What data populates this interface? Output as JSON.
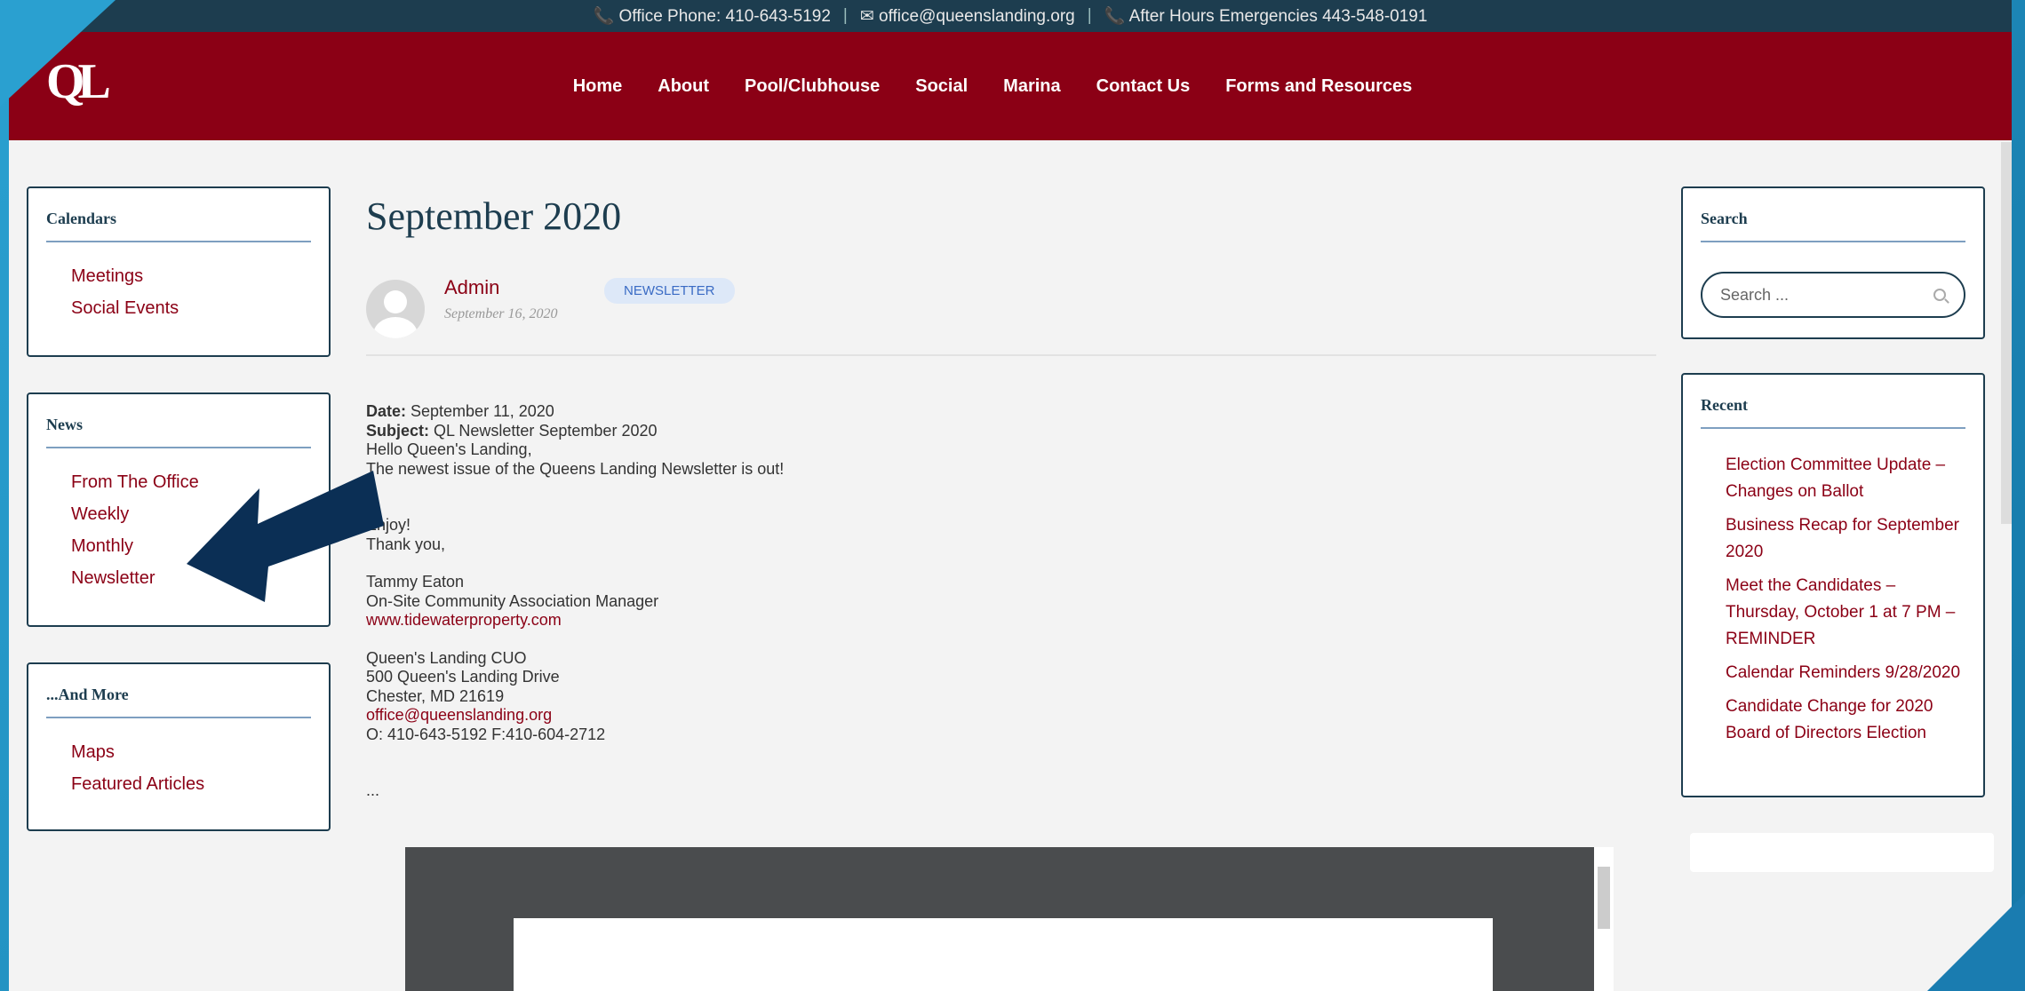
{
  "topbar": {
    "phone": "📞 Office Phone: 410-643-5192",
    "email": "✉ office@queenslanding.org",
    "emergency": "📞 After Hours Emergencies 443-548-0191",
    "separator": "|"
  },
  "logo": "QL",
  "nav": [
    "Home",
    "About",
    "Pool/Clubhouse",
    "Social",
    "Marina",
    "Contact Us",
    "Forms and Resources"
  ],
  "left_widgets": {
    "calendars": {
      "title": "Calendars",
      "items": [
        "Meetings",
        "Social Events"
      ]
    },
    "news": {
      "title": "News",
      "items": [
        "From The Office",
        "Weekly",
        "Monthly",
        "Newsletter"
      ]
    },
    "more": {
      "title": "...And More",
      "items": [
        "Maps",
        "Featured Articles"
      ]
    }
  },
  "post": {
    "title": "September 2020",
    "author": "Admin",
    "date": "September 16, 2020",
    "tag": "NEWSLETTER",
    "date_label": "Date:",
    "date_value": " September 11, 2020",
    "subject_label": "Subject:",
    "subject_value": " QL Newsletter September 2020",
    "greeting": "Hello Queen's Landing,",
    "intro": "The newest issue of the Queens Landing Newsletter is out!",
    "enjoy": "Enjoy!",
    "thanks": "Thank you,",
    "sig_name": "Tammy Eaton",
    "sig_title": "On-Site Community Association Manager",
    "sig_site": "www.tidewaterproperty.com",
    "addr1": "Queen's Landing CUO",
    "addr2": "500 Queen's Landing Drive",
    "addr3": "Chester, MD  21619",
    "addr_email": "office@queenslanding.org",
    "addr_phone": "O: 410-643-5192  F:410-604-2712",
    "ellipsis": "..."
  },
  "right_widgets": {
    "search": {
      "title": "Search",
      "placeholder": "Search ..."
    },
    "recent": {
      "title": "Recent",
      "items": [
        "Election Committee Update – Changes on Ballot",
        "Business Recap for September 2020",
        "Meet the Candidates – Thursday, October 1 at 7 PM – REMINDER",
        "Calendar Reminders 9/28/2020",
        "Candidate Change for 2020 Board of Directors Election"
      ]
    }
  },
  "colors": {
    "accent": "#8b0015",
    "dark": "#1d3d4f",
    "arrow": "#0b2f55"
  },
  "icons": {
    "arrow": "arrow-left-icon",
    "search": "search-icon",
    "avatar": "avatar-icon"
  }
}
